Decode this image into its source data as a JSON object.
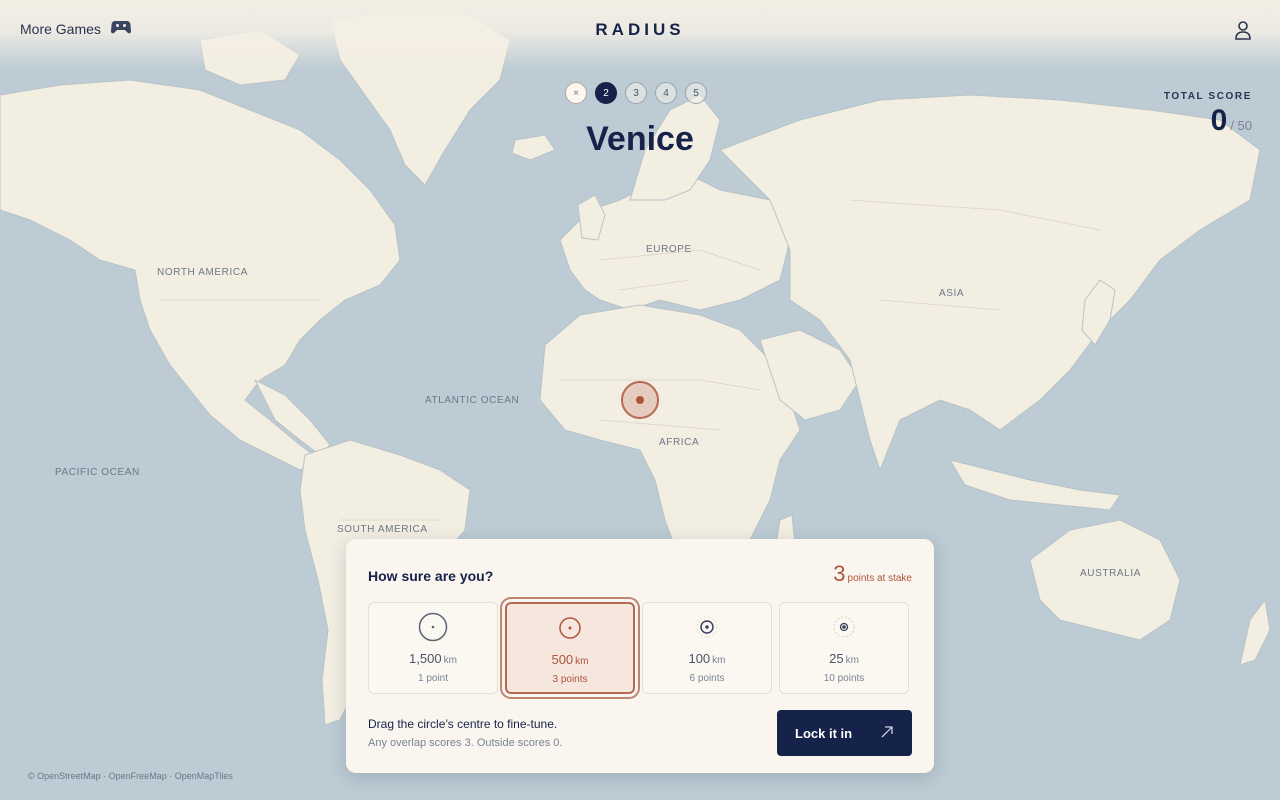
{
  "header": {
    "more_games": "More Games",
    "brand": "RADIUS",
    "icons": {
      "more_games": "gamepad-icon",
      "profile": "user-icon"
    }
  },
  "rounds": {
    "items": [
      "×",
      "2",
      "3",
      "4",
      "5"
    ],
    "current": "2"
  },
  "city": "Venice",
  "score": {
    "label": "TOTAL SCORE",
    "value": "0",
    "max": "/ 50"
  },
  "map": {
    "labels": [
      "NORTH AMERICA",
      "EUROPE",
      "ASIA",
      "ATLANTIC OCEAN",
      "AFRICA",
      "PACIFIC OCEAN",
      "SOUTH AMERICA",
      "AUSTRALIA"
    ],
    "land_color": "#f3eee2",
    "water_color": "#bccbd4",
    "marker_color": "#b0553b"
  },
  "panel": {
    "title": "How sure are you?",
    "stake_value": "3",
    "stake_text": "points at stake",
    "options": [
      {
        "distance": "1,500",
        "unit": "km",
        "points": "1 point",
        "selected": false
      },
      {
        "distance": "500",
        "unit": "km",
        "points": "3 points",
        "selected": true
      },
      {
        "distance": "100",
        "unit": "km",
        "points": "6 points",
        "selected": false
      },
      {
        "distance": "25",
        "unit": "km",
        "points": "10 points",
        "selected": false
      }
    ],
    "hint1": "Drag the circle’s centre to fine-tune.",
    "hint2": "Any overlap scores 3. Outside scores 0.",
    "lock_label": "Lock it in",
    "lock_icon": "arrow-up-right-icon"
  },
  "attribution": "© OpenStreetMap · OpenFreeMap · OpenMapTiles"
}
